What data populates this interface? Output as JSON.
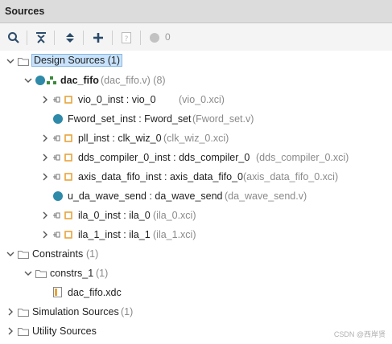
{
  "panel": {
    "title": "Sources"
  },
  "toolbar": {
    "badge_count": "0"
  },
  "tree": {
    "design_sources": {
      "label": "Design Sources (1)"
    },
    "top": {
      "name": "dac_fifo",
      "file": "(dac_fifo.v) (8)"
    },
    "children": [
      {
        "inst": "vio_0_inst : vio_0",
        "file": "(vio_0.xci)",
        "kind": "ip"
      },
      {
        "inst": "Fword_set_inst : Fword_set",
        "file": "(Fword_set.v)",
        "kind": "module"
      },
      {
        "inst": "pll_inst : clk_wiz_0",
        "file": "(clk_wiz_0.xci)",
        "kind": "ip"
      },
      {
        "inst": "dds_compiler_0_inst : dds_compiler_0",
        "file": "(dds_compiler_0.xci)",
        "kind": "ip"
      },
      {
        "inst": "axis_data_fifo_inst : axis_data_fifo_0",
        "file": "(axis_data_fifo_0.xci)",
        "kind": "ip"
      },
      {
        "inst": "u_da_wave_send : da_wave_send",
        "file": "(da_wave_send.v)",
        "kind": "module"
      },
      {
        "inst": "ila_0_inst : ila_0",
        "file": "(ila_0.xci)",
        "kind": "ip"
      },
      {
        "inst": "ila_1_inst : ila_1",
        "file": "(ila_1.xci)",
        "kind": "ip"
      }
    ],
    "constraints": {
      "name": "Constraints",
      "count": "(1)"
    },
    "constrs_1": {
      "name": "constrs_1",
      "count": "(1)"
    },
    "xdc": {
      "name": "dac_fifo.xdc"
    },
    "simulation": {
      "name": "Simulation Sources",
      "count": "(1)"
    },
    "utility": {
      "name": "Utility Sources"
    }
  },
  "watermark": "CSDN @西岸贤",
  "colors": {
    "module_dot": "#2e8aa8",
    "ip_square": "#e8a33a",
    "selection": "#c8e3fb",
    "titlebar": "#dcdcdc"
  }
}
